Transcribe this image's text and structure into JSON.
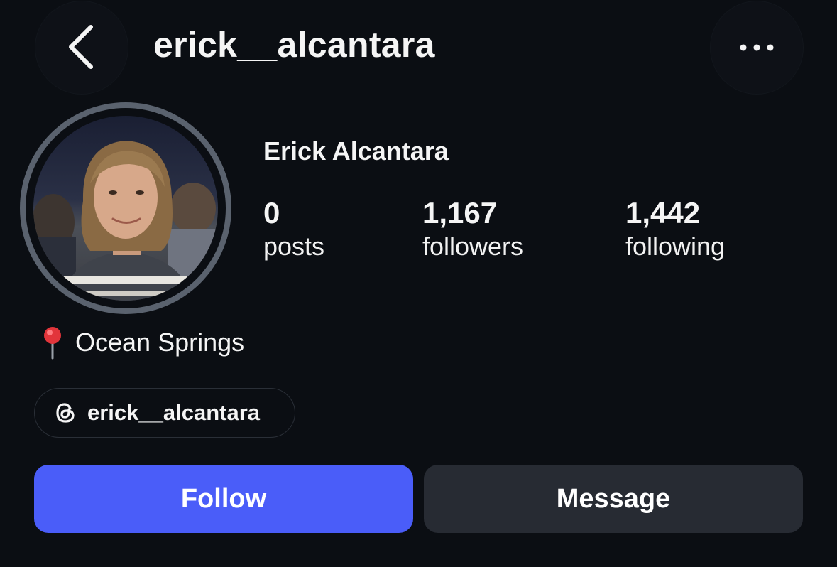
{
  "header": {
    "username": "erick__alcantara",
    "back_icon": "chevron-left-icon",
    "more_icon": "more-horizontal-icon"
  },
  "profile": {
    "display_name": "Erick Alcantara",
    "stats": {
      "posts": {
        "count": "0",
        "label": "posts"
      },
      "followers": {
        "count": "1,167",
        "label": "followers"
      },
      "following": {
        "count": "1,442",
        "label": "following"
      }
    },
    "location": "Ocean Springs",
    "location_icon": "round-pushpin-icon",
    "threads": {
      "icon": "threads-icon",
      "handle": "erick__alcantara"
    }
  },
  "actions": {
    "follow_label": "Follow",
    "message_label": "Message"
  },
  "colors": {
    "background": "#0b0e13",
    "follow_button": "#4a5df9",
    "message_button": "#272b33",
    "avatar_ring": "#5a626e"
  }
}
